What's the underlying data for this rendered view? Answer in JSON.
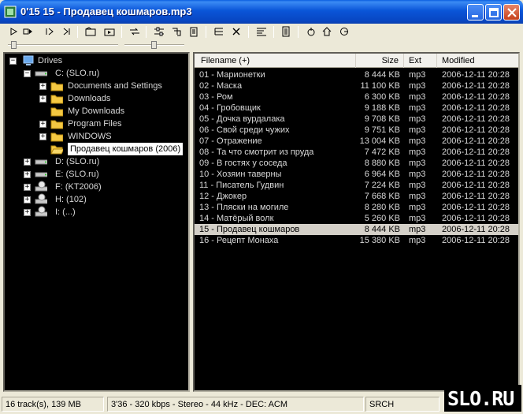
{
  "window": {
    "title": "0'15 15 - Продавец кошмаров.mp3",
    "buttons": [
      "minimize-icon",
      "maximize-icon",
      "close-icon"
    ]
  },
  "toolbar": {
    "icons": [
      "play-icon",
      "play-to-icon",
      "stop-icon",
      "stop-after-icon",
      "prev-folder-icon",
      "next-folder-icon",
      "shuffle-icon",
      "settings-icon",
      "tag-icon",
      "file-info-icon",
      "list-icon",
      "remove-icon",
      "sort-icon",
      "notes-icon",
      "refresh-icon",
      "home-icon",
      "bookmark-icon"
    ]
  },
  "tree": {
    "root": "Drives",
    "nodes": [
      {
        "label": "C: (SLO.ru)",
        "icon": "disk-drive-icon",
        "expanded": true
      },
      {
        "label": "Documents and Settings",
        "icon": "folder-icon",
        "expandable": true
      },
      {
        "label": "Downloads",
        "icon": "folder-icon",
        "expandable": true
      },
      {
        "label": "My Downloads",
        "icon": "folder-icon",
        "expandable": false
      },
      {
        "label": "Program Files",
        "icon": "folder-icon",
        "expandable": true
      },
      {
        "label": "WINDOWS",
        "icon": "folder-icon",
        "expandable": true
      },
      {
        "label": "Продавец кошмаров (2006)",
        "icon": "folder-open-icon",
        "expandable": false,
        "selected": true
      },
      {
        "label": "D: (SLO.ru)",
        "icon": "disk-drive-icon"
      },
      {
        "label": "E: (SLO.ru)",
        "icon": "disk-drive-icon"
      },
      {
        "label": "F: (KT2006)",
        "icon": "cd-drive-icon"
      },
      {
        "label": "H: (102)",
        "icon": "cd-drive-icon"
      },
      {
        "label": "I: (...)",
        "icon": "cd-drive-icon"
      }
    ]
  },
  "list": {
    "columns": [
      "Filename (+)",
      "Size",
      "Ext",
      "Modified"
    ],
    "rows": [
      {
        "name": "01 - Марионетки",
        "size": "8 444 KB",
        "ext": "mp3",
        "modified": "2006-12-11 20:28"
      },
      {
        "name": "02 - Маска",
        "size": "11 100 KB",
        "ext": "mp3",
        "modified": "2006-12-11 20:28"
      },
      {
        "name": "03 - Ром",
        "size": "6 300 KB",
        "ext": "mp3",
        "modified": "2006-12-11 20:28"
      },
      {
        "name": "04 - Гробовщик",
        "size": "9 188 KB",
        "ext": "mp3",
        "modified": "2006-12-11 20:28"
      },
      {
        "name": "05 - Дочка вурдалака",
        "size": "9 708 KB",
        "ext": "mp3",
        "modified": "2006-12-11 20:28"
      },
      {
        "name": "06 - Свой среди чужих",
        "size": "9 751 KB",
        "ext": "mp3",
        "modified": "2006-12-11 20:28"
      },
      {
        "name": "07 - Отражение",
        "size": "13 004 KB",
        "ext": "mp3",
        "modified": "2006-12-11 20:28"
      },
      {
        "name": "08 - Та что смотрит из пруда",
        "size": "7 472 KB",
        "ext": "mp3",
        "modified": "2006-12-11 20:28"
      },
      {
        "name": "09 - В гостях у соседа",
        "size": "8 880 KB",
        "ext": "mp3",
        "modified": "2006-12-11 20:28"
      },
      {
        "name": "10 - Хозяин таверны",
        "size": "6 964 KB",
        "ext": "mp3",
        "modified": "2006-12-11 20:28"
      },
      {
        "name": "11 - Писатель Гудвин",
        "size": "7 224 KB",
        "ext": "mp3",
        "modified": "2006-12-11 20:28"
      },
      {
        "name": "12 - Джокер",
        "size": "7 668 KB",
        "ext": "mp3",
        "modified": "2006-12-11 20:28"
      },
      {
        "name": "13 - Пляски на могиле",
        "size": "8 280 KB",
        "ext": "mp3",
        "modified": "2006-12-11 20:28"
      },
      {
        "name": "14 - Матёрый волк",
        "size": "5 260 KB",
        "ext": "mp3",
        "modified": "2006-12-11 20:28"
      },
      {
        "name": "15 - Продавец кошмаров",
        "size": "8 444 KB",
        "ext": "mp3",
        "modified": "2006-12-11 20:28",
        "selected": true
      },
      {
        "name": "16 - Рецепт Монаха",
        "size": "15 380 KB",
        "ext": "mp3",
        "modified": "2006-12-11 20:28"
      }
    ]
  },
  "status": {
    "tracks": "16 track(s), 139 MB",
    "info": "3'36 - 320 kbps - Stereo - 44 kHz - DEC: ACM",
    "mode": "SRCH"
  },
  "logo": {
    "text": "SLO.RU"
  },
  "colors": {
    "titlebar": "#0a55d8",
    "panel_bg": "#000000",
    "panel_text": "#d8d8d8",
    "selection": "#d4d0c8",
    "folder": "#f4c842"
  }
}
